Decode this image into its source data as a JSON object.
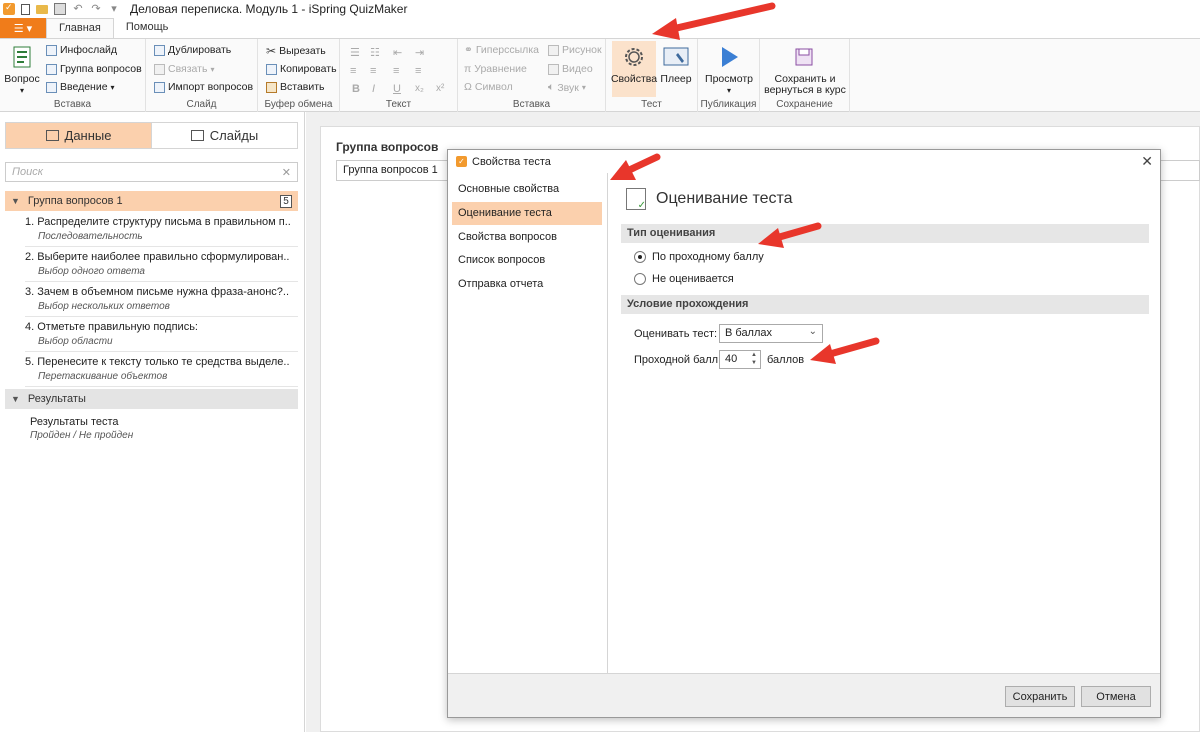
{
  "window": {
    "title": "Деловая переписка. Модуль 1 - iSpring QuizMaker"
  },
  "ribbon_tabs": {
    "file": "☰ ▾",
    "home": "Главная",
    "help": "Помощь"
  },
  "ribbon": {
    "insert_group": {
      "label": "Вставка",
      "question": "Вопрос",
      "infoslide": "Инфослайд",
      "question_group": "Группа вопросов",
      "intro": "Введение"
    },
    "slide_group": {
      "label": "Слайд",
      "duplicate": "Дублировать",
      "link": "Связать",
      "import": "Импорт вопросов"
    },
    "clipboard_group": {
      "label": "Буфер обмена",
      "cut": "Вырезать",
      "copy": "Копировать",
      "paste": "Вставить"
    },
    "text_group": {
      "label": "Текст",
      "bold": "B",
      "italic": "I",
      "underline": "U",
      "subscript": "x₂",
      "superscript": "x²"
    },
    "insert2_group": {
      "label": "Вставка",
      "hyperlink": "Гиперссылка",
      "equation": "Уравнение",
      "symbol": "Символ",
      "picture": "Рисунок",
      "video": "Видео",
      "sound": "Звук"
    },
    "test_group": {
      "label": "Тест",
      "properties": "Свойства",
      "player": "Плеер"
    },
    "publish_group": {
      "label": "Публикация",
      "preview": "Просмотр"
    },
    "save_group": {
      "label": "Сохранение",
      "save_line1": "Сохранить и",
      "save_line2": "вернуться в курс"
    }
  },
  "left_panel": {
    "tab_data": "Данные",
    "tab_slides": "Слайды",
    "search_placeholder": "Поиск",
    "question_group": {
      "title": "Группа вопросов 1",
      "count": "5",
      "items": [
        {
          "title": "1. Распределите структуру письма в правильном п...",
          "type": "Последовательность"
        },
        {
          "title": "2. Выберите наиболее правильно сформулирован...",
          "type": "Выбор одного ответа"
        },
        {
          "title": "3. Зачем в объемном письме нужна фраза-анонс?...",
          "type": "Выбор нескольких ответов"
        },
        {
          "title": "4. Отметьте правильную подпись:",
          "type": "Выбор области"
        },
        {
          "title": "5. Перенесите к тексту только те средства выделе...",
          "type": "Перетаскивание объектов"
        }
      ]
    },
    "results": {
      "title": "Результаты",
      "item_title": "Результаты теста",
      "item_subtitle": "Пройден / Не пройден"
    }
  },
  "main": {
    "group_label": "Группа вопросов",
    "group_name": "Группа вопросов 1"
  },
  "dialog": {
    "title": "Свойства теста",
    "nav": [
      "Основные свойства",
      "Оценивание теста",
      "Свойства вопросов",
      "Список вопросов",
      "Отправка отчета"
    ],
    "heading": "Оценивание теста",
    "section_type": "Тип оценивания",
    "radio_pass": "По проходному баллу",
    "radio_none": "Не оценивается",
    "section_condition": "Условие прохождения",
    "eval_label": "Оценивать тест:",
    "eval_value": "В баллах",
    "pass_label": "Проходной балл:",
    "pass_value": "40",
    "pass_unit": "баллов",
    "save_button": "Сохранить",
    "cancel_button": "Отмена"
  },
  "colors": {
    "accent": "#f07c1a",
    "selection": "#fbd0ad",
    "arrow": "#e8362b"
  }
}
